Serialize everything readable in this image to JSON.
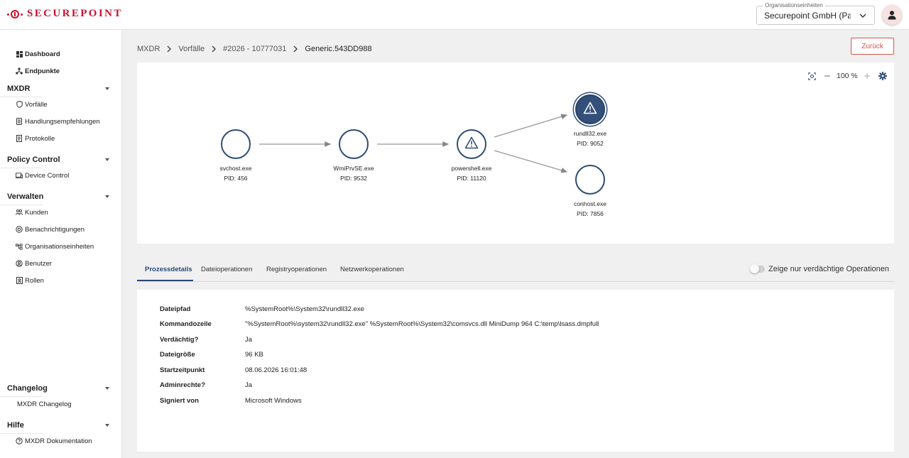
{
  "header": {
    "logo_text": "SECUREPOINT",
    "org_legend": "Organisationseinheiten",
    "org_value": "Securepoint GmbH (Partner)"
  },
  "sidebar": {
    "top_items": [
      {
        "label": "Dashboard",
        "icon": "dashboard-icon"
      },
      {
        "label": "Endpunkte",
        "icon": "network-icon"
      }
    ],
    "sections": [
      {
        "title": "MXDR",
        "items": [
          {
            "label": "Vorfälle",
            "icon": "shield-icon"
          },
          {
            "label": "Handlungsempfehlungen",
            "icon": "list-icon"
          },
          {
            "label": "Protokolle",
            "icon": "document-icon"
          }
        ]
      },
      {
        "title": "Policy Control",
        "items": [
          {
            "label": "Device Control",
            "icon": "device-icon"
          }
        ]
      },
      {
        "title": "Verwalten",
        "items": [
          {
            "label": "Kunden",
            "icon": "people-icon"
          },
          {
            "label": "Benachrichtigungen",
            "icon": "bell-icon"
          },
          {
            "label": "Organisationseinheiten",
            "icon": "org-icon"
          },
          {
            "label": "Benutzer",
            "icon": "user-icon"
          },
          {
            "label": "Rollen",
            "icon": "badge-icon"
          }
        ]
      },
      {
        "title": "Changelog",
        "items": [
          {
            "label": "MXDR Changelog",
            "icon": ""
          }
        ]
      },
      {
        "title": "Hilfe",
        "items": [
          {
            "label": "MXDR Dokumentation",
            "icon": "help-icon"
          }
        ]
      }
    ]
  },
  "breadcrumb": [
    "MXDR",
    "Vorfälle",
    "#2026 - 10777031",
    "Generic.543DD988"
  ],
  "back_button": "Zurück",
  "graph": {
    "zoom": "100 %",
    "nodes": [
      {
        "name": "svchost.exe",
        "pid": "PID: 456",
        "alert": false
      },
      {
        "name": "WmiPrvSE.exe",
        "pid": "PID: 9532",
        "alert": false
      },
      {
        "name": "powershell.exe",
        "pid": "PID: 11120",
        "alert": "warning"
      },
      {
        "name": "rundll32.exe",
        "pid": "PID: 9052",
        "alert": "selected"
      },
      {
        "name": "conhost.exe",
        "pid": "PID: 7856",
        "alert": false
      }
    ]
  },
  "tabs": [
    "Prozessdetails",
    "Dateioperationen",
    "Registryoperationen",
    "Netzwerkoperationen"
  ],
  "toggle_label": "Zeige nur verdächtige Operationen",
  "details": [
    {
      "key": "Dateipfad",
      "value": "%SystemRoot%\\System32\\rundll32.exe"
    },
    {
      "key": "Kommandozeile",
      "value": "\"%SystemRoot%\\system32\\rundll32.exe\" %SystemRoot%\\System32\\comsvcs.dll MiniDump 964 C:\\temp\\lsass.dmpfull"
    },
    {
      "key": "Verdächtig?",
      "value": "Ja"
    },
    {
      "key": "Dateigröße",
      "value": "96 KB"
    },
    {
      "key": "Startzeitpunkt",
      "value": "08.06.2026 16:01:48"
    },
    {
      "key": "Adminrechte?",
      "value": "Ja"
    },
    {
      "key": "Signiert von",
      "value": "Microsoft Windows"
    }
  ],
  "colors": {
    "accent": "#264a78",
    "brand": "#c8102e",
    "danger": "#d9534f"
  }
}
